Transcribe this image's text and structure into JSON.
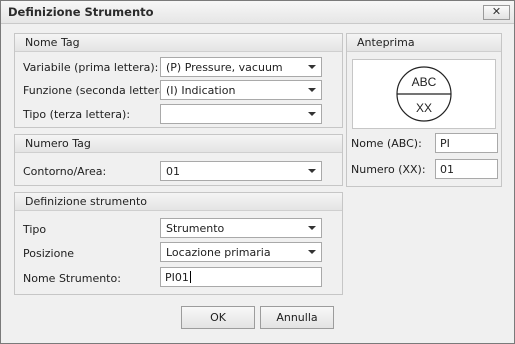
{
  "window": {
    "title": "Definizione Strumento",
    "close_symbol": "✕"
  },
  "nome_tag": {
    "title": "Nome Tag",
    "variabile": {
      "label": "Variabile (prima lettera):",
      "value": "(P) Pressure, vacuum"
    },
    "funzione": {
      "label": "Funzione (seconda lettera):",
      "value": "(I) Indication"
    },
    "tipo": {
      "label": "Tipo (terza lettera):",
      "value": ""
    }
  },
  "numero_tag": {
    "title": "Numero Tag",
    "contorno": {
      "label": "Contorno/Area:",
      "value": "01"
    }
  },
  "definizione_strumento": {
    "title": "Definizione strumento",
    "tipo": {
      "label": "Tipo",
      "value": "Strumento"
    },
    "posizione": {
      "label": "Posizione",
      "value": "Locazione primaria"
    },
    "nome": {
      "label": "Nome Strumento:",
      "value": "PI01"
    }
  },
  "anteprima": {
    "title": "Anteprima",
    "symbol_top": "ABC",
    "symbol_bottom": "XX",
    "nome": {
      "label": "Nome (ABC):",
      "value": "PI"
    },
    "numero": {
      "label": "Numero (XX):",
      "value": "01"
    }
  },
  "buttons": {
    "ok": "OK",
    "annulla": "Annulla"
  }
}
